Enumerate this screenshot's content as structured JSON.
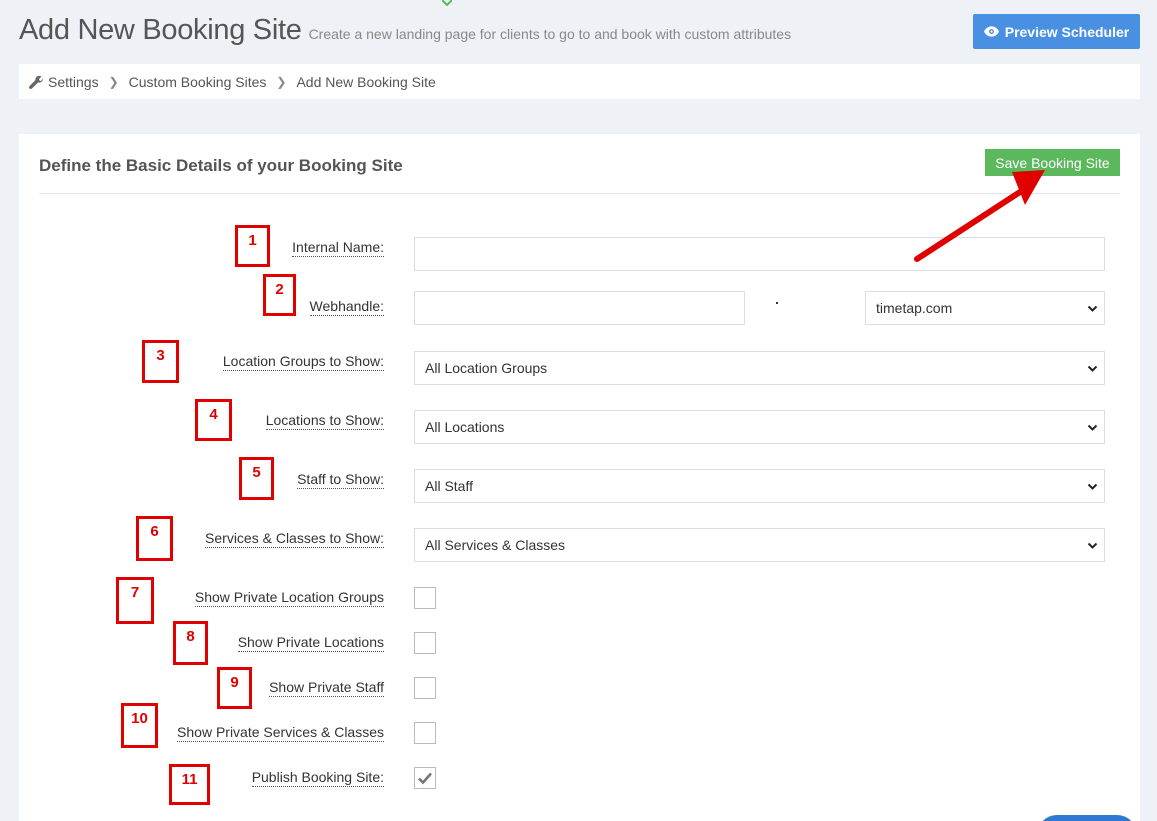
{
  "header": {
    "title": "Add New Booking Site",
    "subtitle": "Create a new landing page for clients to go to and book with custom attributes",
    "preview_button": "Preview Scheduler"
  },
  "breadcrumb": {
    "items": [
      "Settings",
      "Custom Booking Sites",
      "Add New Booking Site"
    ]
  },
  "card": {
    "title": "Define the Basic Details of your Booking Site",
    "save_button": "Save Booking Site"
  },
  "form": {
    "internal_name": {
      "label": "Internal Name:",
      "value": ""
    },
    "webhandle": {
      "label": "Webhandle:",
      "value": "",
      "domain": "timetap.com"
    },
    "location_groups": {
      "label": "Location Groups to Show:",
      "value": "All Location Groups"
    },
    "locations": {
      "label": "Locations to Show:",
      "value": "All Locations"
    },
    "staff": {
      "label": "Staff to Show:",
      "value": "All Staff"
    },
    "services": {
      "label": "Services & Classes to Show:",
      "value": "All Services & Classes"
    },
    "show_private_location_groups": {
      "label": "Show Private Location Groups",
      "checked": false
    },
    "show_private_locations": {
      "label": "Show Private Locations",
      "checked": false
    },
    "show_private_staff": {
      "label": "Show Private Staff",
      "checked": false
    },
    "show_private_services": {
      "label": "Show Private Services & Classes",
      "checked": false
    },
    "publish": {
      "label": "Publish Booking Site:",
      "checked": true
    }
  },
  "annotations": {
    "markers": [
      "1",
      "2",
      "3",
      "4",
      "5",
      "6",
      "7",
      "8",
      "9",
      "10",
      "11"
    ],
    "color": "#e00000"
  },
  "colors": {
    "preview_button": "#4a90e2",
    "save_button": "#5cb85c",
    "background": "#eef1f5"
  }
}
